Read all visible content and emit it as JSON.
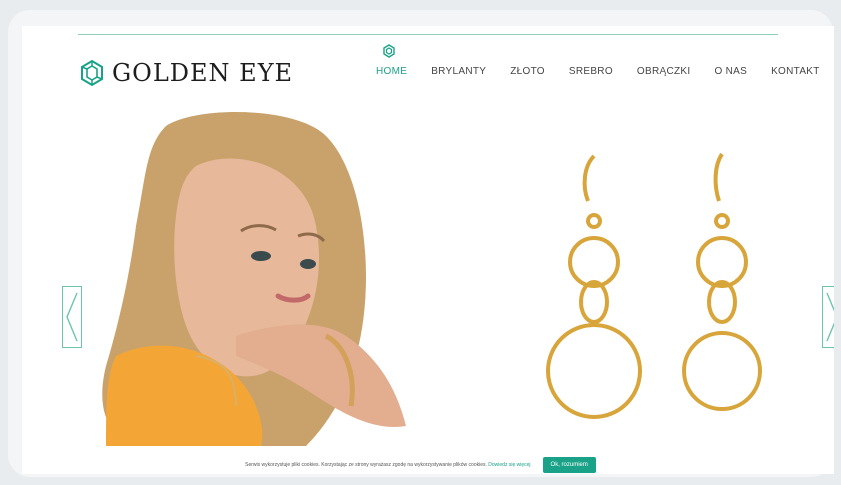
{
  "brand": {
    "name": "GOLDEN EYE",
    "accent": "#1aa289"
  },
  "nav": {
    "items": [
      "HOME",
      "BRYLANTY",
      "ZŁOTO",
      "SREBRO",
      "OBRĄCZKI",
      "O NAS",
      "KONTAKT"
    ],
    "active": "HOME"
  },
  "hero": {
    "left_arrow_icon": "chevron-left-icon",
    "right_arrow_icon": "chevron-right-icon",
    "image_left": "woman-portrait",
    "image_right": "gold-hoop-earrings"
  },
  "cookie": {
    "text": "Serwis wykorzystuje pliki cookies. Korzystając ze strony wyrażasz zgodę na wykorzystywanie plików cookies.",
    "link": "Dowiedz się więcej",
    "button": "Ok, rozumiem"
  }
}
